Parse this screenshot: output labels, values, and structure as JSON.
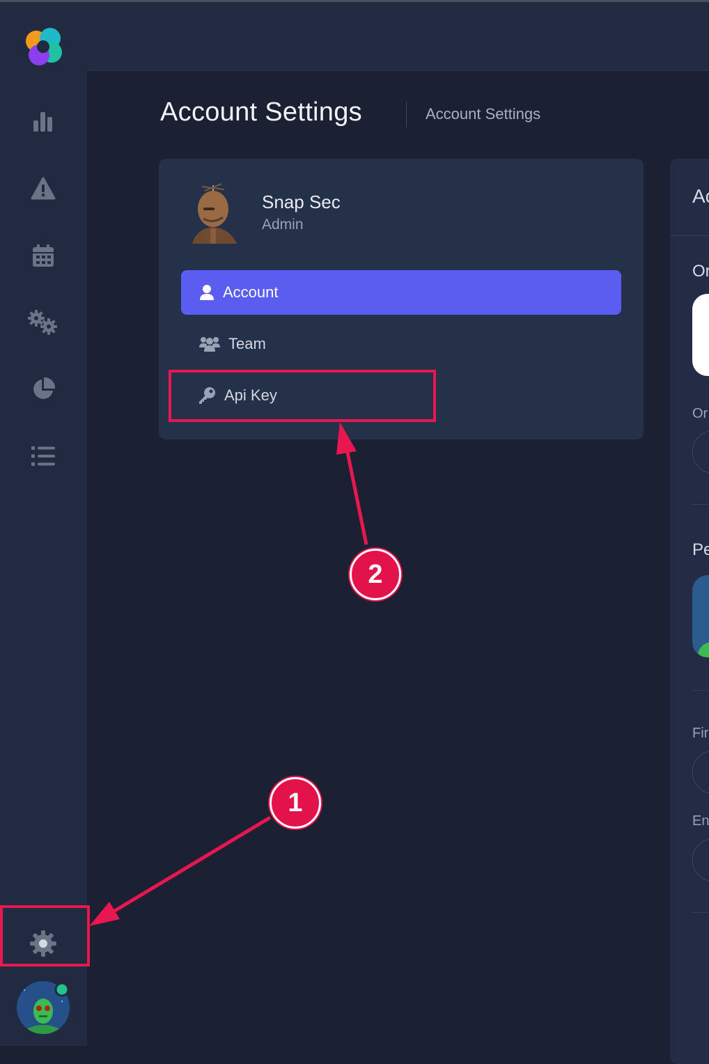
{
  "header": {
    "page_title": "Account Settings",
    "breadcrumb": "Account Settings"
  },
  "sidebar": {
    "logo": "app-logo",
    "items": [
      {
        "icon": "bar-chart-icon"
      },
      {
        "icon": "warning-icon"
      },
      {
        "icon": "calendar-icon"
      },
      {
        "icon": "gears-icon"
      },
      {
        "icon": "pie-chart-icon"
      },
      {
        "icon": "list-icon"
      }
    ],
    "settings_icon": "gear-icon",
    "avatar_status_color": "#22c38e"
  },
  "profile": {
    "name": "Snap Sec",
    "role": "Admin"
  },
  "menu": {
    "account": "Account",
    "team": "Team",
    "api_key": "Api Key"
  },
  "right_panel": {
    "heading": "Ac",
    "section1": "Or",
    "label1": "Or",
    "section2": "Pe",
    "label_first": "Fir",
    "label_email": "En"
  },
  "annotations": {
    "step1": "1",
    "step2": "2"
  },
  "colors": {
    "accent": "#5b5cf0",
    "highlight": "#e8174f",
    "background": "#1b2033"
  }
}
